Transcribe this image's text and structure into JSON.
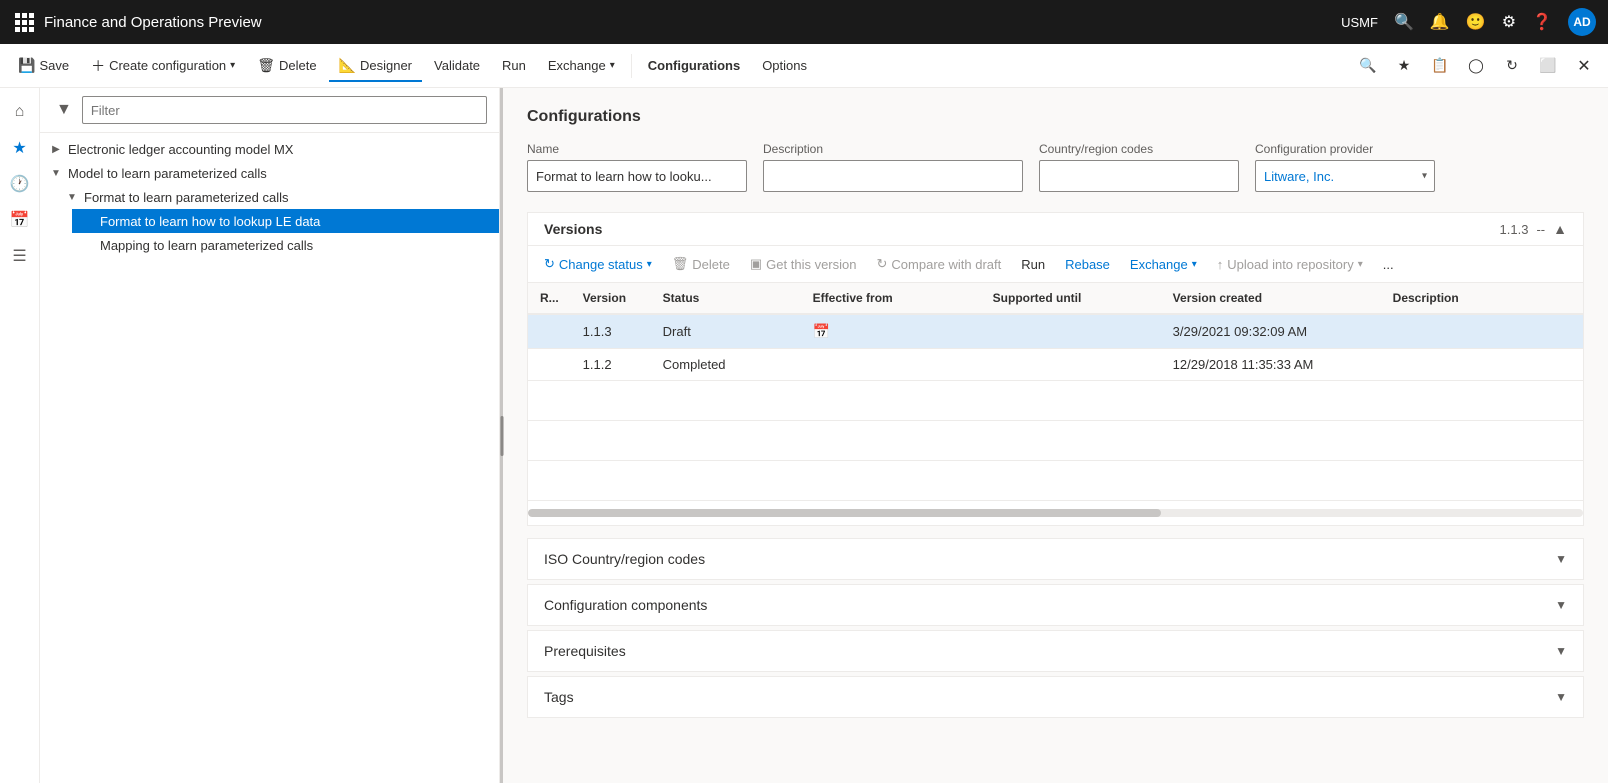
{
  "app": {
    "title": "Finance and Operations Preview",
    "user": "USMF",
    "avatar": "AD"
  },
  "toolbar": {
    "save_label": "Save",
    "create_configuration_label": "Create configuration",
    "delete_label": "Delete",
    "designer_label": "Designer",
    "validate_label": "Validate",
    "run_label": "Run",
    "exchange_label": "Exchange",
    "configurations_label": "Configurations",
    "options_label": "Options"
  },
  "sidebar": {
    "filter_placeholder": "Filter",
    "items": [
      {
        "label": "Electronic ledger accounting model MX",
        "indent": 0,
        "expanded": false,
        "id": "item-0"
      },
      {
        "label": "Model to learn parameterized calls",
        "indent": 0,
        "expanded": true,
        "id": "item-1"
      },
      {
        "label": "Format to learn parameterized calls",
        "indent": 1,
        "expanded": true,
        "id": "item-2"
      },
      {
        "label": "Format to learn how to lookup LE data",
        "indent": 2,
        "selected": true,
        "active": true,
        "id": "item-3"
      },
      {
        "label": "Mapping to learn parameterized calls",
        "indent": 2,
        "id": "item-4"
      }
    ]
  },
  "content": {
    "section_title": "Configurations",
    "form": {
      "name_label": "Name",
      "name_value": "Format to learn how to looku...",
      "description_label": "Description",
      "description_value": "",
      "country_label": "Country/region codes",
      "country_value": "",
      "provider_label": "Configuration provider",
      "provider_value": "Litware, Inc."
    },
    "versions": {
      "title": "Versions",
      "badge": "1.1.3",
      "separator": "--",
      "toolbar": {
        "change_status": "Change status",
        "delete": "Delete",
        "get_this_version": "Get this version",
        "compare_with_draft": "Compare with draft",
        "run": "Run",
        "rebase": "Rebase",
        "exchange": "Exchange",
        "upload_into_repository": "Upload into repository",
        "more": "..."
      },
      "columns": [
        "R...",
        "Version",
        "Status",
        "Effective from",
        "Supported until",
        "Version created",
        "Description"
      ],
      "rows": [
        {
          "r": "",
          "version": "1.1.3",
          "status": "Draft",
          "effective_from": "",
          "supported_until": "",
          "version_created": "3/29/2021 09:32:09 AM",
          "description": "",
          "selected": true
        },
        {
          "r": "",
          "version": "1.1.2",
          "status": "Completed",
          "effective_from": "",
          "supported_until": "",
          "version_created": "12/29/2018 11:35:33 AM",
          "description": "",
          "selected": false
        }
      ]
    },
    "iso_codes": {
      "title": "ISO Country/region codes"
    },
    "config_components": {
      "title": "Configuration components"
    },
    "prerequisites": {
      "title": "Prerequisites"
    },
    "tags": {
      "title": "Tags"
    }
  }
}
